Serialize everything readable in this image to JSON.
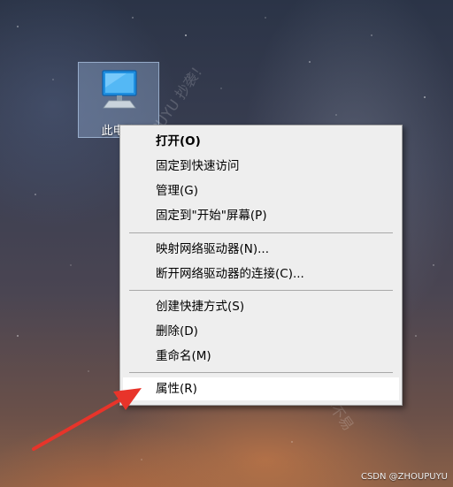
{
  "desktop": {
    "icon_label": "此电脑",
    "icon_name": "computer-icon"
  },
  "context_menu": {
    "items": [
      {
        "label": "打开(O)",
        "bold": true
      },
      {
        "label": "固定到快速访问"
      },
      {
        "label": "管理(G)"
      },
      {
        "label": "固定到\"开始\"屏幕(P)"
      },
      {
        "label": "映射网络驱动器(N)..."
      },
      {
        "label": "断开网络驱动器的连接(C)..."
      },
      {
        "label": "创建快捷方式(S)"
      },
      {
        "label": "删除(D)"
      },
      {
        "label": "重命名(M)"
      },
      {
        "label": "属性(R)",
        "highlighted": true
      }
    ],
    "highlight_color": "#ffffff"
  },
  "watermarks": {
    "diagonal_text": "@HOPUYU 抄袭！",
    "side_text": "创作不易"
  },
  "annotation": {
    "arrow_color": "#e8342a"
  },
  "credit": "CSDN @ZHOUPUYU"
}
